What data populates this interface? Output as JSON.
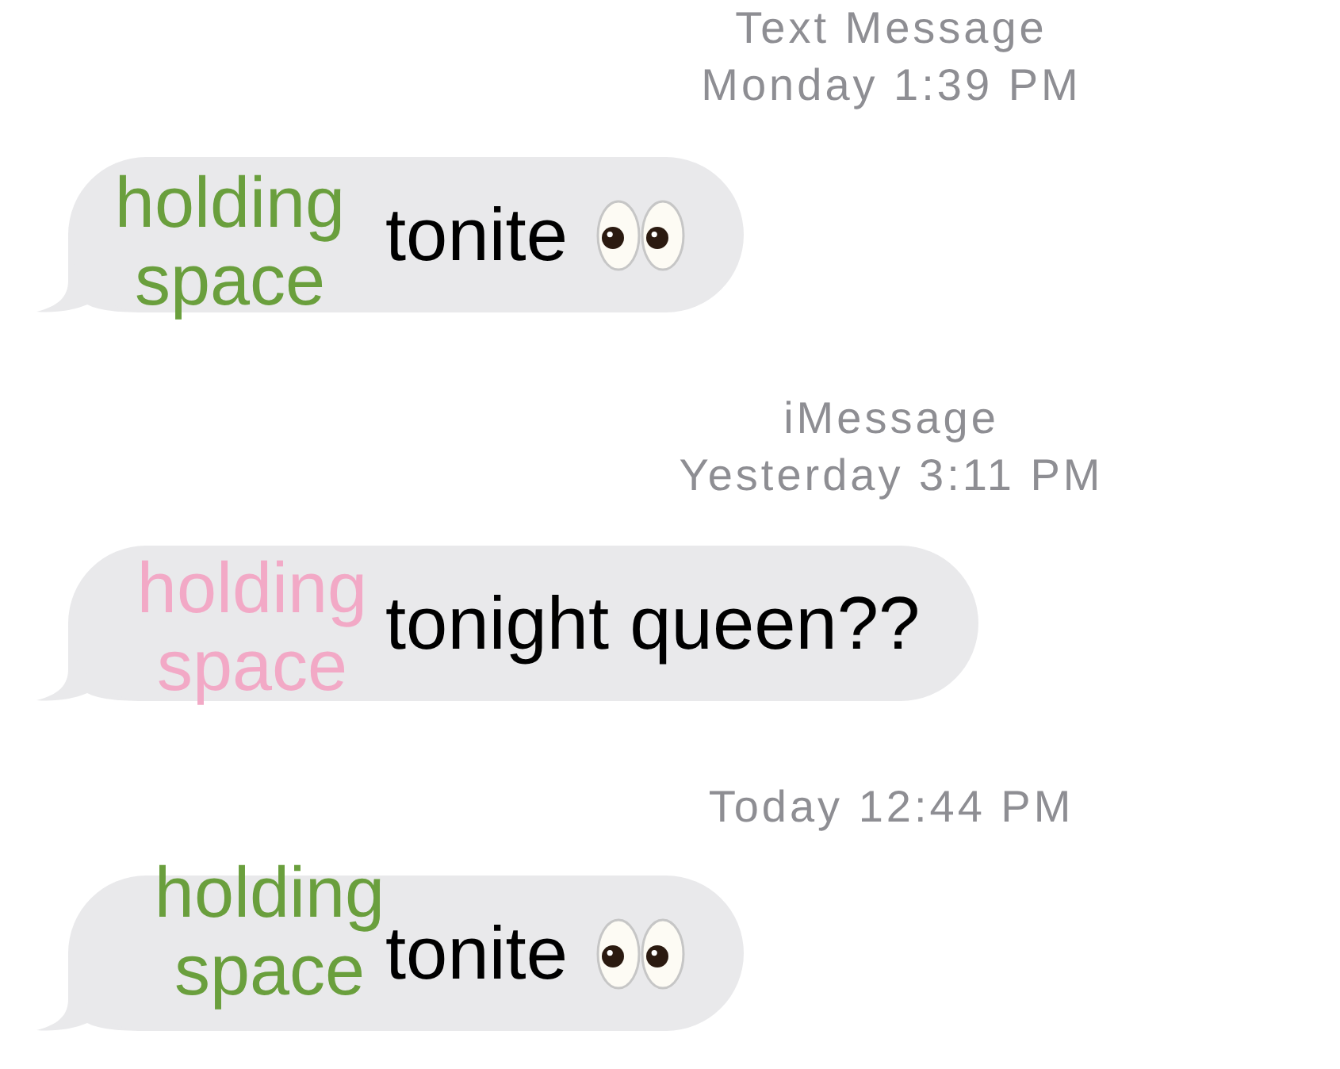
{
  "conversation": [
    {
      "kind": "timestamp",
      "service": "Text Message",
      "time": "Monday 1:39 PM"
    },
    {
      "kind": "message",
      "text": "tonite",
      "emoji_after": true,
      "overlay": {
        "text": "holding space",
        "color": "#6a9f3d"
      }
    },
    {
      "kind": "timestamp",
      "service": "iMessage",
      "time": "Yesterday 3:11 PM"
    },
    {
      "kind": "message",
      "text": "tonight queen??",
      "emoji_after": false,
      "overlay": {
        "text": "holding space",
        "color": "#f2a9c6"
      }
    },
    {
      "kind": "timestamp",
      "time": "Today 12:44 PM"
    },
    {
      "kind": "message",
      "text": "tonite",
      "emoji_after": true,
      "overlay": {
        "text": "holding space",
        "color": "#6a9f3d"
      }
    }
  ]
}
